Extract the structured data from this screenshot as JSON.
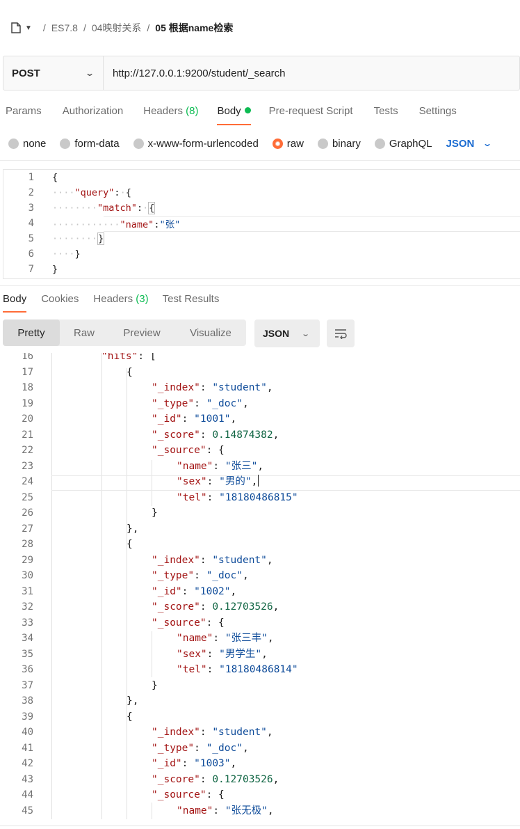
{
  "breadcrumb": {
    "items": [
      "ES7.8",
      "04映射关系",
      "05 根据name检索"
    ],
    "separator": "/"
  },
  "request": {
    "method": "POST",
    "url": "http://127.0.0.1:9200/student/_search"
  },
  "request_tabs": [
    {
      "label": "Params"
    },
    {
      "label": "Authorization"
    },
    {
      "label": "Headers",
      "count": "(8)"
    },
    {
      "label": "Body",
      "active": true
    },
    {
      "label": "Pre-request Script"
    },
    {
      "label": "Tests"
    },
    {
      "label": "Settings"
    }
  ],
  "body_types": [
    "none",
    "form-data",
    "x-www-form-urlencoded",
    "raw",
    "binary",
    "GraphQL"
  ],
  "body_type_selected": "raw",
  "body_format": "JSON",
  "request_code": {
    "line_numbers": [
      "1",
      "2",
      "3",
      "4",
      "5",
      "6",
      "7"
    ],
    "open_brace": "{",
    "query_key": "\"query\"",
    "match_key": "\"match\"",
    "name_key": "\"name\"",
    "name_value": "\"张\"",
    "colon": ":",
    "close_brace": "}"
  },
  "response_tabs": [
    {
      "label": "Body",
      "active": true
    },
    {
      "label": "Cookies"
    },
    {
      "label": "Headers",
      "count": "(3)"
    },
    {
      "label": "Test Results"
    }
  ],
  "response_views": [
    "Pretty",
    "Raw",
    "Preview",
    "Visualize"
  ],
  "response_view_selected": "Pretty",
  "response_format": "JSON",
  "response_lines": [
    {
      "n": "16",
      "indent": 2,
      "parts": [
        [
          "key",
          "\"hits\""
        ],
        [
          "p",
          ": ["
        ]
      ]
    },
    {
      "n": "17",
      "indent": 3,
      "parts": [
        [
          "p",
          "{"
        ]
      ]
    },
    {
      "n": "18",
      "indent": 4,
      "parts": [
        [
          "key",
          "\"_index\""
        ],
        [
          "p",
          ": "
        ],
        [
          "str",
          "\"student\""
        ],
        [
          "p",
          ","
        ]
      ]
    },
    {
      "n": "19",
      "indent": 4,
      "parts": [
        [
          "key",
          "\"_type\""
        ],
        [
          "p",
          ": "
        ],
        [
          "str",
          "\"_doc\""
        ],
        [
          "p",
          ","
        ]
      ]
    },
    {
      "n": "20",
      "indent": 4,
      "parts": [
        [
          "key",
          "\"_id\""
        ],
        [
          "p",
          ": "
        ],
        [
          "str",
          "\"1001\""
        ],
        [
          "p",
          ","
        ]
      ]
    },
    {
      "n": "21",
      "indent": 4,
      "parts": [
        [
          "key",
          "\"_score\""
        ],
        [
          "p",
          ": "
        ],
        [
          "num",
          "0.14874382"
        ],
        [
          "p",
          ","
        ]
      ]
    },
    {
      "n": "22",
      "indent": 4,
      "parts": [
        [
          "key",
          "\"_source\""
        ],
        [
          "p",
          ": {"
        ]
      ]
    },
    {
      "n": "23",
      "indent": 5,
      "parts": [
        [
          "key",
          "\"name\""
        ],
        [
          "p",
          ": "
        ],
        [
          "str",
          "\"张三\""
        ],
        [
          "p",
          ","
        ]
      ]
    },
    {
      "n": "24",
      "indent": 5,
      "parts": [
        [
          "key",
          "\"sex\""
        ],
        [
          "p",
          ": "
        ],
        [
          "str",
          "\"男的\""
        ],
        [
          "p",
          ","
        ]
      ],
      "cursor": true
    },
    {
      "n": "25",
      "indent": 5,
      "parts": [
        [
          "key",
          "\"tel\""
        ],
        [
          "p",
          ": "
        ],
        [
          "str",
          "\"18180486815\""
        ]
      ]
    },
    {
      "n": "26",
      "indent": 4,
      "parts": [
        [
          "p",
          "}"
        ]
      ]
    },
    {
      "n": "27",
      "indent": 3,
      "parts": [
        [
          "p",
          "},"
        ]
      ]
    },
    {
      "n": "28",
      "indent": 3,
      "parts": [
        [
          "p",
          "{"
        ]
      ]
    },
    {
      "n": "29",
      "indent": 4,
      "parts": [
        [
          "key",
          "\"_index\""
        ],
        [
          "p",
          ": "
        ],
        [
          "str",
          "\"student\""
        ],
        [
          "p",
          ","
        ]
      ]
    },
    {
      "n": "30",
      "indent": 4,
      "parts": [
        [
          "key",
          "\"_type\""
        ],
        [
          "p",
          ": "
        ],
        [
          "str",
          "\"_doc\""
        ],
        [
          "p",
          ","
        ]
      ]
    },
    {
      "n": "31",
      "indent": 4,
      "parts": [
        [
          "key",
          "\"_id\""
        ],
        [
          "p",
          ": "
        ],
        [
          "str",
          "\"1002\""
        ],
        [
          "p",
          ","
        ]
      ]
    },
    {
      "n": "32",
      "indent": 4,
      "parts": [
        [
          "key",
          "\"_score\""
        ],
        [
          "p",
          ": "
        ],
        [
          "num",
          "0.12703526"
        ],
        [
          "p",
          ","
        ]
      ]
    },
    {
      "n": "33",
      "indent": 4,
      "parts": [
        [
          "key",
          "\"_source\""
        ],
        [
          "p",
          ": {"
        ]
      ]
    },
    {
      "n": "34",
      "indent": 5,
      "parts": [
        [
          "key",
          "\"name\""
        ],
        [
          "p",
          ": "
        ],
        [
          "str",
          "\"张三丰\""
        ],
        [
          "p",
          ","
        ]
      ]
    },
    {
      "n": "35",
      "indent": 5,
      "parts": [
        [
          "key",
          "\"sex\""
        ],
        [
          "p",
          ": "
        ],
        [
          "str",
          "\"男学生\""
        ],
        [
          "p",
          ","
        ]
      ]
    },
    {
      "n": "36",
      "indent": 5,
      "parts": [
        [
          "key",
          "\"tel\""
        ],
        [
          "p",
          ": "
        ],
        [
          "str",
          "\"18180486814\""
        ]
      ]
    },
    {
      "n": "37",
      "indent": 4,
      "parts": [
        [
          "p",
          "}"
        ]
      ]
    },
    {
      "n": "38",
      "indent": 3,
      "parts": [
        [
          "p",
          "},"
        ]
      ]
    },
    {
      "n": "39",
      "indent": 3,
      "parts": [
        [
          "p",
          "{"
        ]
      ]
    },
    {
      "n": "40",
      "indent": 4,
      "parts": [
        [
          "key",
          "\"_index\""
        ],
        [
          "p",
          ": "
        ],
        [
          "str",
          "\"student\""
        ],
        [
          "p",
          ","
        ]
      ]
    },
    {
      "n": "41",
      "indent": 4,
      "parts": [
        [
          "key",
          "\"_type\""
        ],
        [
          "p",
          ": "
        ],
        [
          "str",
          "\"_doc\""
        ],
        [
          "p",
          ","
        ]
      ]
    },
    {
      "n": "42",
      "indent": 4,
      "parts": [
        [
          "key",
          "\"_id\""
        ],
        [
          "p",
          ": "
        ],
        [
          "str",
          "\"1003\""
        ],
        [
          "p",
          ","
        ]
      ]
    },
    {
      "n": "43",
      "indent": 4,
      "parts": [
        [
          "key",
          "\"_score\""
        ],
        [
          "p",
          ": "
        ],
        [
          "num",
          "0.12703526"
        ],
        [
          "p",
          ","
        ]
      ]
    },
    {
      "n": "44",
      "indent": 4,
      "parts": [
        [
          "key",
          "\"_source\""
        ],
        [
          "p",
          ": {"
        ]
      ]
    },
    {
      "n": "45",
      "indent": 5,
      "parts": [
        [
          "key",
          "\"name\""
        ],
        [
          "p",
          ": "
        ],
        [
          "str",
          "\"张无极\""
        ],
        [
          "p",
          ","
        ]
      ]
    }
  ],
  "colors": {
    "accent": "#ff6c37",
    "count_green": "#0cbb52",
    "key_red": "#a31515",
    "string_blue": "#0f4c9a",
    "number_green": "#116644",
    "json_link": "#1a6bd1"
  },
  "icons": {
    "collection": "document-icon",
    "caret": "caret-down-icon",
    "method_chevron": "chevron-down-icon",
    "wrap": "wrap-lines-icon"
  }
}
